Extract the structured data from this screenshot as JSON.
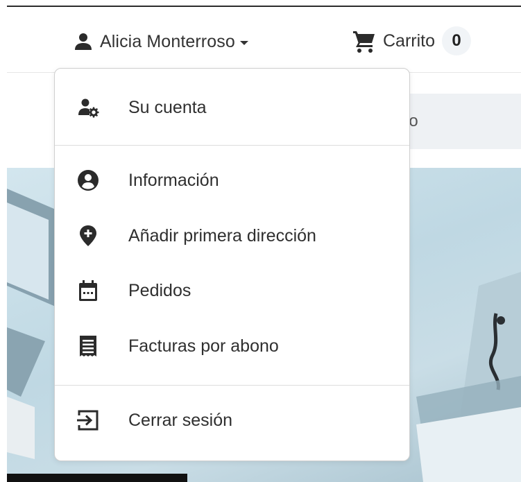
{
  "header": {
    "user_name": "Alicia Monterroso",
    "cart_label": "Carrito",
    "cart_count": "0"
  },
  "search": {
    "placeholder_fragment": "go"
  },
  "account_menu": {
    "items": [
      {
        "label": "Su cuenta",
        "icon": "user-gear-icon"
      },
      {
        "label": "Información",
        "icon": "user-circle-icon"
      },
      {
        "label": "Añadir primera dirección",
        "icon": "map-pin-plus-icon"
      },
      {
        "label": "Pedidos",
        "icon": "calendar-icon"
      },
      {
        "label": "Facturas por abono",
        "icon": "receipt-icon"
      },
      {
        "label": "Cerrar sesión",
        "icon": "logout-icon"
      }
    ]
  },
  "colors": {
    "text": "#333333",
    "icon": "#2b2b2b",
    "cart_badge_bg": "#f1f4f7",
    "search_bg": "#eef1f4"
  }
}
